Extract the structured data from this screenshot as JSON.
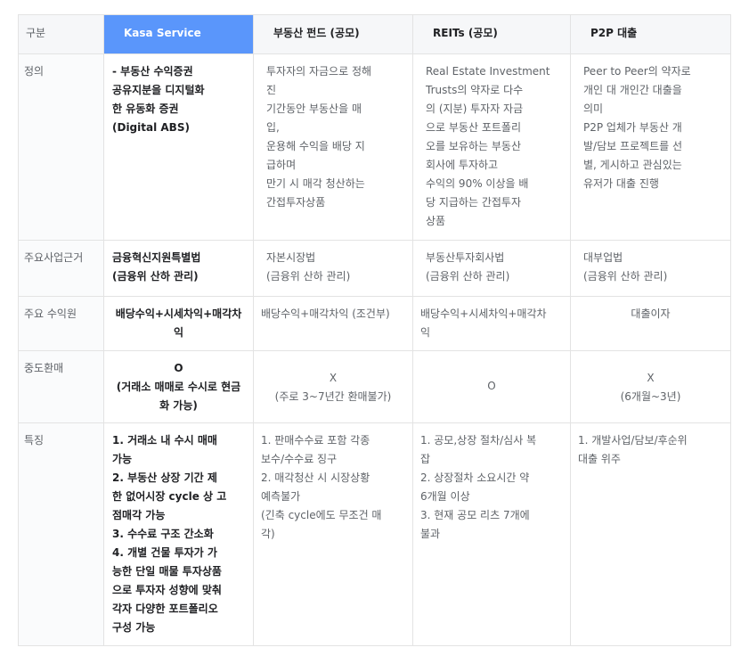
{
  "header": {
    "category": "구분",
    "kasa": "Kasa Service",
    "fund": "부동산 펀드 (공모)",
    "reits": "REITs (공모)",
    "p2p": "P2P 대출"
  },
  "rows": {
    "definition": {
      "label": "정의",
      "kasa": "- 부동산 수익증권\n공유지분을 디지털화\n한 유동화 증권\n(Digital ABS)",
      "fund": "투자자의 자금으로 정해\n진\n기간동안 부동산을 매\n입,\n운용해 수익을 배당 지\n급하며\n만기 시 매각 청산하는\n간접투자상품",
      "reits": "Real Estate Investment\nTrusts의 약자로 다수\n의 (지분) 투자자 자금\n으로 부동산 포트폴리\n오를 보유하는 부동산\n회사에 투자하고\n수익의 90% 이상을 배\n당 지급하는 간접투자\n상품",
      "p2p": "Peer to Peer의 약자로\n개인 대 개인간 대출을\n의미\nP2P 업체가 부동산 개\n발/담보 프로젝트를 선\n별, 게시하고 관심있는\n유저가 대출 진행"
    },
    "legal_basis": {
      "label": "주요사업근거",
      "kasa": "금융혁신지원특별법\n(금융위 산하 관리)",
      "fund": "자본시장법\n(금융위 산하 관리)",
      "reits": "부동산투자회사법\n(금융위 산하 관리)",
      "p2p": "대부업법\n(금융위 산하 관리)"
    },
    "revenue": {
      "label": "주요 수익원",
      "kasa": "배당수익+시세차익+매각차\n익",
      "fund": "배당수익+매각차익 (조건부)",
      "reits": "배당수익+시세차익+매각차\n익",
      "p2p": "대출이자"
    },
    "redemption": {
      "label": "중도환매",
      "kasa": "O\n(거래소 매매로 수시로 현금\n화 가능)",
      "fund": "X\n(주로 3~7년간 환매불가)",
      "reits": "O",
      "p2p": "X\n(6개월~3년)"
    },
    "features": {
      "label": "특징",
      "kasa": "1. 거래소 내 수시 매매\n가능\n2. 부동산 상장 기간 제\n한 없어시장 cycle 상 고\n점매각 가능\n3. 수수료 구조 간소화\n4. 개별 건물 투자가 가\n능한 단일 매물 투자상품\n으로 투자자 성향에 맞춰\n각자 다양한 포트폴리오\n구성 가능",
      "fund": "1. 판매수수료 포함 각종\n보수/수수료 징구\n2. 매각청산 시 시장상황\n예측불가\n(긴축 cycle에도 무조건 매\n각)",
      "reits": "1. 공모,상장 절차/심사 복\n잡\n2. 상장절차 소요시간 약\n6개월 이상\n3. 현재 공모 리츠 7개에\n불과",
      "p2p": "1. 개발사업/담보/후순위\n대출 위주"
    }
  },
  "colors": {
    "kasa_header_bg": "#5a96fb",
    "header_bg": "#f6f7f9",
    "border": "#e3e3e3"
  }
}
